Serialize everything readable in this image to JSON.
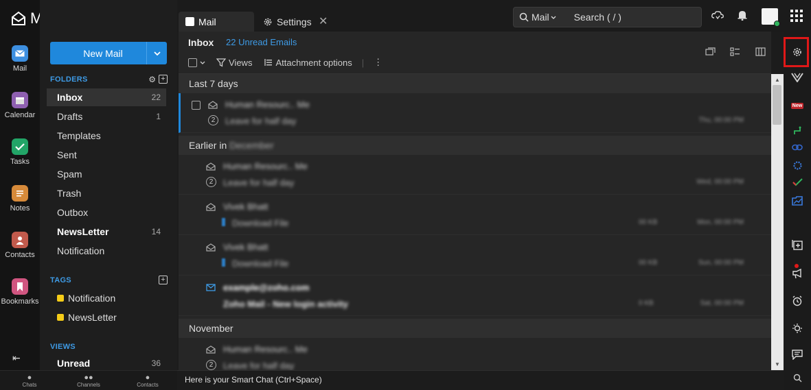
{
  "app": {
    "name": "Mail"
  },
  "rail": [
    {
      "label": "Mail",
      "color": "#3d8fe0"
    },
    {
      "label": "Calendar",
      "color": "#8e5fb0"
    },
    {
      "label": "Tasks",
      "color": "#22a567"
    },
    {
      "label": "Notes",
      "color": "#d68a3a"
    },
    {
      "label": "Contacts",
      "color": "#c15a4c"
    },
    {
      "label": "Bookmarks",
      "color": "#d05580"
    }
  ],
  "new_mail_label": "New Mail",
  "folders_header": "FOLDERS",
  "folders": [
    {
      "name": "Inbox",
      "count": "22"
    },
    {
      "name": "Drafts",
      "count": "1"
    },
    {
      "name": "Templates",
      "count": ""
    },
    {
      "name": "Sent",
      "count": ""
    },
    {
      "name": "Spam",
      "count": ""
    },
    {
      "name": "Trash",
      "count": ""
    },
    {
      "name": "Outbox",
      "count": ""
    },
    {
      "name": "NewsLetter",
      "count": "14"
    },
    {
      "name": "Notification",
      "count": ""
    }
  ],
  "tags_header": "TAGS",
  "tags": [
    {
      "name": "Notification",
      "color": "#f5cc17"
    },
    {
      "name": "NewsLetter",
      "color": "#f5cc17"
    }
  ],
  "views_header": "VIEWS",
  "views": [
    {
      "name": "Unread",
      "count": "36"
    }
  ],
  "bottom_bar": [
    "Chats",
    "Channels",
    "Contacts"
  ],
  "tabs": {
    "mail": "Mail",
    "settings": "Settings"
  },
  "search": {
    "scope": "Mail",
    "placeholder": "Search ( / )"
  },
  "list": {
    "title": "Inbox",
    "unread": "22 Unread Emails",
    "views": "Views",
    "attachment_options": "Attachment options",
    "groups": [
      "Last 7 days",
      "Earlier in",
      "November"
    ],
    "earlier_blurred": "December",
    "rows": [
      {
        "sender": "Human Resourc.. Me",
        "subject": "Leave for half day",
        "thread": "2",
        "size": "",
        "date": "Thu, 00:00 PM"
      },
      {
        "sender": "Human Resourc.. Me",
        "subject": "Leave for half day",
        "thread": "2",
        "size": "",
        "date": "Wed, 00:00 PM"
      },
      {
        "sender": "Vivek Bhatt",
        "subject": "Download File",
        "thread": "",
        "size": "00 KB",
        "date": "Mon, 00:00 PM"
      },
      {
        "sender": "Vivek Bhatt",
        "subject": "Download File",
        "thread": "",
        "size": "00 KB",
        "date": "Sun, 00:00 PM"
      },
      {
        "sender": "example@zoho.com",
        "subject": "Zoho Mail - New login activity",
        "thread": "",
        "size": "0 KB",
        "date": "Sat, 00:00 PM"
      },
      {
        "sender": "Human Resourc.. Me",
        "subject": "Leave for half day",
        "thread": "2",
        "size": "",
        "date": ""
      }
    ]
  },
  "smart_chat": "Here is your Smart Chat (Ctrl+Space)",
  "right_sidebar": {
    "new_badge": "New"
  }
}
